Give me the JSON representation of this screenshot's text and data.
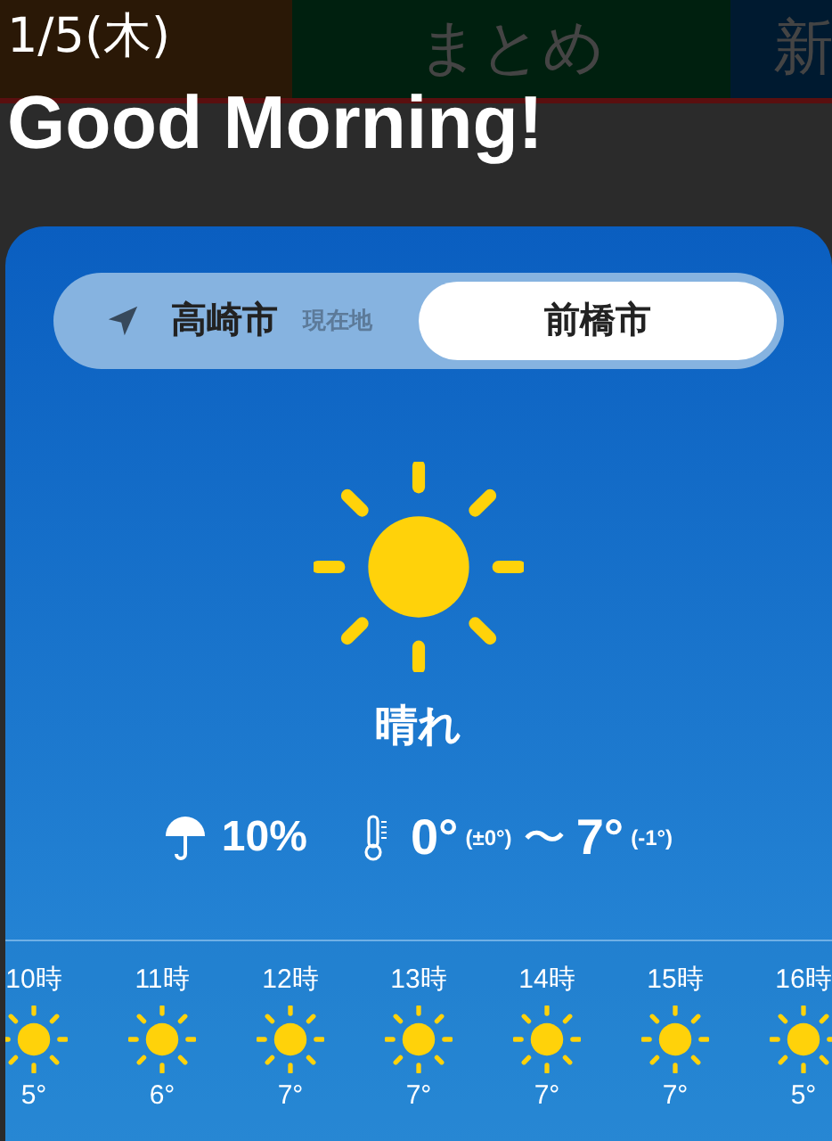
{
  "background_tabs": [
    {
      "label": "まとめ",
      "color": "#00200f"
    },
    {
      "label": "新",
      "color": "#001a30"
    }
  ],
  "date": "1/5(木)",
  "greeting": "Good Morning!",
  "location_toggle": [
    {
      "label": "高崎市",
      "sublabel": "現在地",
      "kind": "current",
      "selected": false
    },
    {
      "label": "前橋市",
      "kind": "city",
      "selected": true
    }
  ],
  "weather": {
    "condition": "晴れ",
    "precipitation": "10%",
    "low": "0°",
    "low_diff": "(±0°)",
    "separator": "〜",
    "high": "7°",
    "high_diff": "(-1°)"
  },
  "hourly": [
    {
      "time": "10時",
      "temp": "5°",
      "kind": "sunny"
    },
    {
      "time": "11時",
      "temp": "6°",
      "kind": "sunny"
    },
    {
      "time": "12時",
      "temp": "7°",
      "kind": "sunny"
    },
    {
      "time": "13時",
      "temp": "7°",
      "kind": "sunny"
    },
    {
      "time": "14時",
      "temp": "7°",
      "kind": "sunny"
    },
    {
      "time": "15時",
      "temp": "7°",
      "kind": "sunny"
    },
    {
      "time": "16時",
      "temp": "5°",
      "kind": "sunny"
    }
  ]
}
